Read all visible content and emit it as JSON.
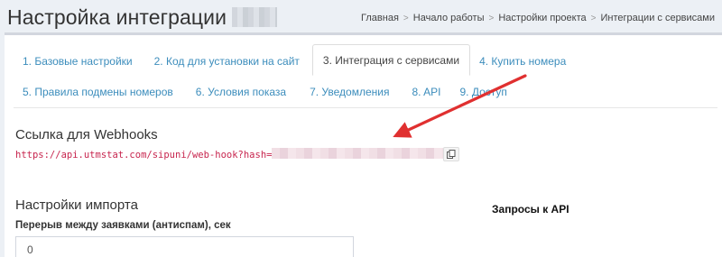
{
  "header": {
    "title": "Настройка интеграции",
    "breadcrumb": [
      "Главная",
      "Начало работы",
      "Настройки проекта",
      "Интеграции с сервисами"
    ]
  },
  "tabs": {
    "row1": [
      {
        "label": "1. Базовые настройки",
        "active": false
      },
      {
        "label": "2. Код для установки на сайт",
        "active": false
      },
      {
        "label": "3. Интеграция с сервисами",
        "active": true
      },
      {
        "label": "4. Купить номера",
        "active": false
      }
    ],
    "row2": [
      {
        "label": "5. Правила подмены номеров",
        "active": false
      },
      {
        "label": "6. Условия показа",
        "active": false
      },
      {
        "label": "7. Уведомления",
        "active": false
      },
      {
        "label": "8. API",
        "active": false
      },
      {
        "label": "9. Доступ",
        "active": false
      }
    ]
  },
  "webhooks": {
    "title": "Ссылка для Webhooks",
    "url_prefix": "https://api.utmstat.com/sipuni/web-hook?hash=",
    "copy_icon": "copy-icon"
  },
  "import": {
    "title": "Настройки импорта",
    "field_label": "Перерыв между заявками (антиспам), сек",
    "field_value": "0"
  },
  "api": {
    "label": "Запросы к API"
  },
  "colors": {
    "link": "#3c8dbc",
    "code": "#c7254e",
    "annotation_arrow": "#e03030"
  }
}
